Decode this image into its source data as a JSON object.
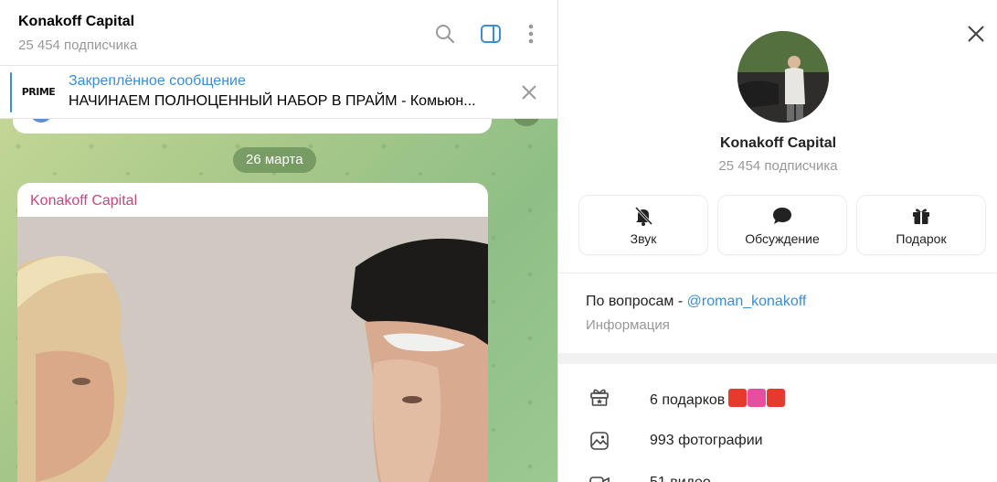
{
  "chat": {
    "title": "Konakoff Capital",
    "subtitle": "25 454 подписчика",
    "icons": [
      "search-icon",
      "sidebar-toggle-icon",
      "more-vertical-icon"
    ],
    "pinned": {
      "label": "Закреплённое сообщение",
      "text": "НАЧИНАЕМ ПОЛНОЦЕННЫЙ НАБОР В ПРАЙМ   - Комьюн...",
      "thumb_text": "PRIME"
    },
    "date": "26 марта",
    "post": {
      "author": "Konakoff Capital"
    }
  },
  "profile": {
    "name": "Konakoff Capital",
    "subscribers": "25 454 подписчика",
    "actions": [
      {
        "label": "Звук",
        "icon": "bell-off-icon"
      },
      {
        "label": "Обсуждение",
        "icon": "chat-bubble-icon"
      },
      {
        "label": "Подарок",
        "icon": "gift-icon"
      }
    ],
    "about": {
      "prefix": "По вопросам - ",
      "link": "@roman_konakoff",
      "label": "Информация"
    },
    "media": [
      {
        "label": "6 подарков",
        "icon": "gift-star-icon"
      },
      {
        "label": "993 фотографии",
        "icon": "photo-icon"
      },
      {
        "label": "51 видео",
        "icon": "video-icon"
      }
    ]
  },
  "colors": {
    "accent": "#3a8ed6",
    "author": "#c64680",
    "muted": "#999999"
  }
}
